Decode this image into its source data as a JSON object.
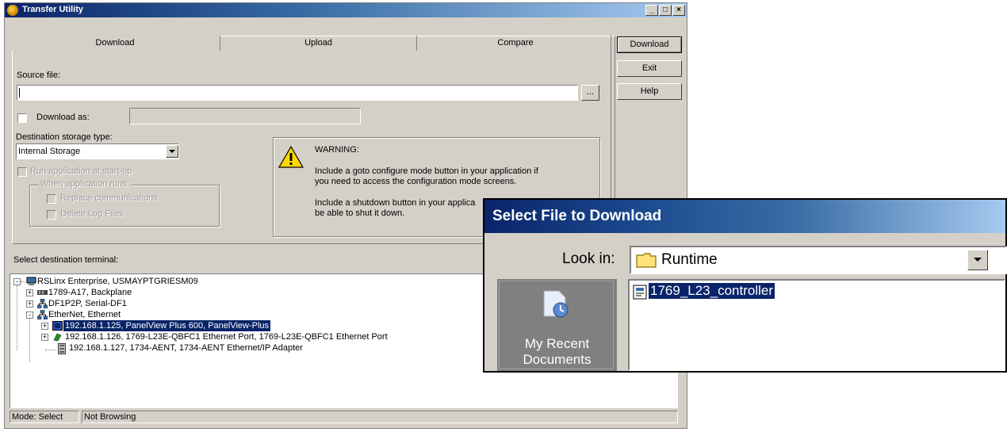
{
  "window": {
    "title": "Transfer Utility",
    "controls": [
      "_",
      "□",
      "×"
    ]
  },
  "tabs": [
    "Download",
    "Upload",
    "Compare"
  ],
  "side_buttons": [
    "Download",
    "Exit",
    "Help"
  ],
  "source": {
    "label": "Source file:",
    "value": "",
    "browse_label": "..."
  },
  "download_as": {
    "label": "Download as:",
    "checked": false,
    "value": ""
  },
  "destination": {
    "label": "Destination storage type:",
    "selected": "Internal Storage"
  },
  "options": {
    "run_at_startup": "Run application at start-up",
    "group_label": "When application runs:",
    "replace_comm": "Replace communications",
    "delete_logs": "Delete Log Files"
  },
  "warning": {
    "title": "WARNING:",
    "line1a": "Include a goto configure mode button in your application if",
    "line1b": "you need to access the configuration mode screens.",
    "line2a": "Include a shutdown button in your applica",
    "line2b": "be able to shut it down."
  },
  "terminal": {
    "label": "Select destination terminal:",
    "tree": [
      {
        "text": "RSLinx Enterprise, USMAYPTGRIESM09",
        "icon": "computer-icon",
        "toggle": "-"
      },
      {
        "text": "1789-A17, Backplane",
        "icon": "backplane-icon",
        "toggle": "+"
      },
      {
        "text": "DF1P2P, Serial-DF1",
        "icon": "network-icon",
        "toggle": "+"
      },
      {
        "text": "EtherNet, Ethernet",
        "icon": "network-icon",
        "toggle": "-"
      },
      {
        "text": "192.168.1.125, PanelView Plus 600, PanelView-Plus",
        "icon": "panelview-icon",
        "toggle": "+",
        "selected": true
      },
      {
        "text": "192.168.1.126, 1769-L23E-QBFC1 Ethernet Port, 1769-L23E-QBFC1 Ethernet Port",
        "icon": "controller-icon",
        "toggle": "+"
      },
      {
        "text": "192.168.1.127, 1734-AENT, 1734-AENT Ethernet/IP Adapter",
        "icon": "adapter-icon",
        "toggle": ""
      }
    ]
  },
  "status": {
    "mode": "Mode: Select",
    "browse": "Not Browsing"
  },
  "file_dialog": {
    "title": "Select File to Download",
    "look_in_label": "Look in:",
    "look_in_value": "Runtime",
    "place": "My Recent\nDocuments",
    "place_line1": "My Recent",
    "place_line2": "Documents",
    "files": [
      "1769_L23_controller"
    ]
  },
  "colors": {
    "title_start": "#0a246a",
    "title_end": "#a6caf0",
    "selection": "#0a246a",
    "face": "#d4d0c8",
    "warning": "#ffd800"
  }
}
